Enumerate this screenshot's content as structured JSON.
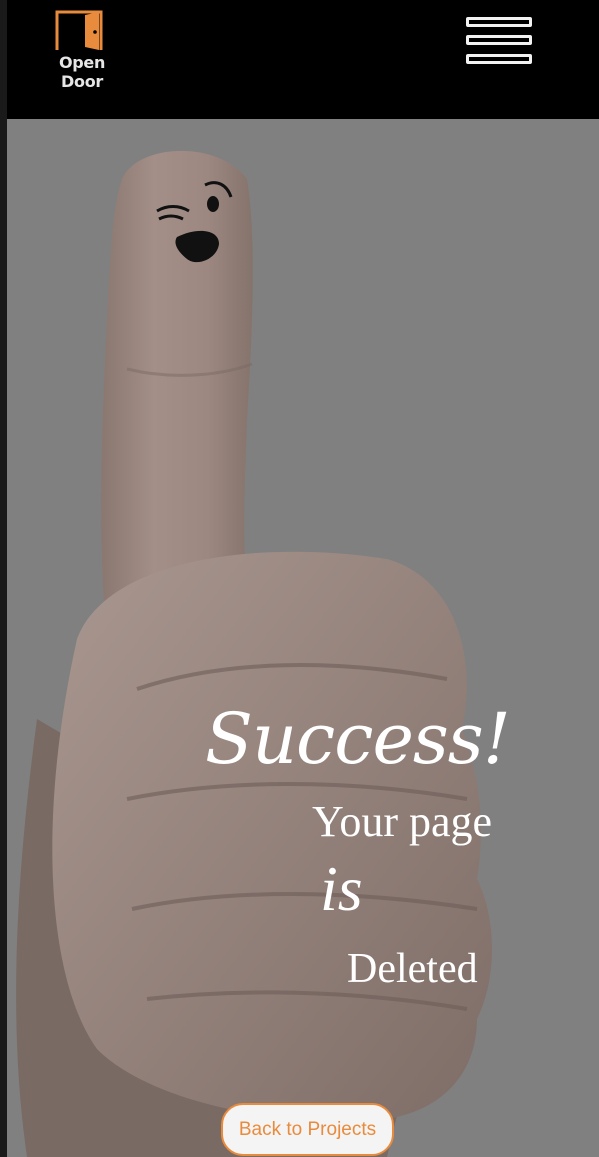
{
  "navbar": {
    "logo_text": "Open Door",
    "logo_icon": "door-icon",
    "menu_icon": "hamburger-menu-icon",
    "accent": "#e98b3c"
  },
  "hero": {
    "headline": "Success!",
    "line1": "Your page",
    "line2": "is",
    "line3": "Deleted",
    "overlay_color": "#808080"
  },
  "actions": {
    "back_label": "Back to Projects"
  }
}
